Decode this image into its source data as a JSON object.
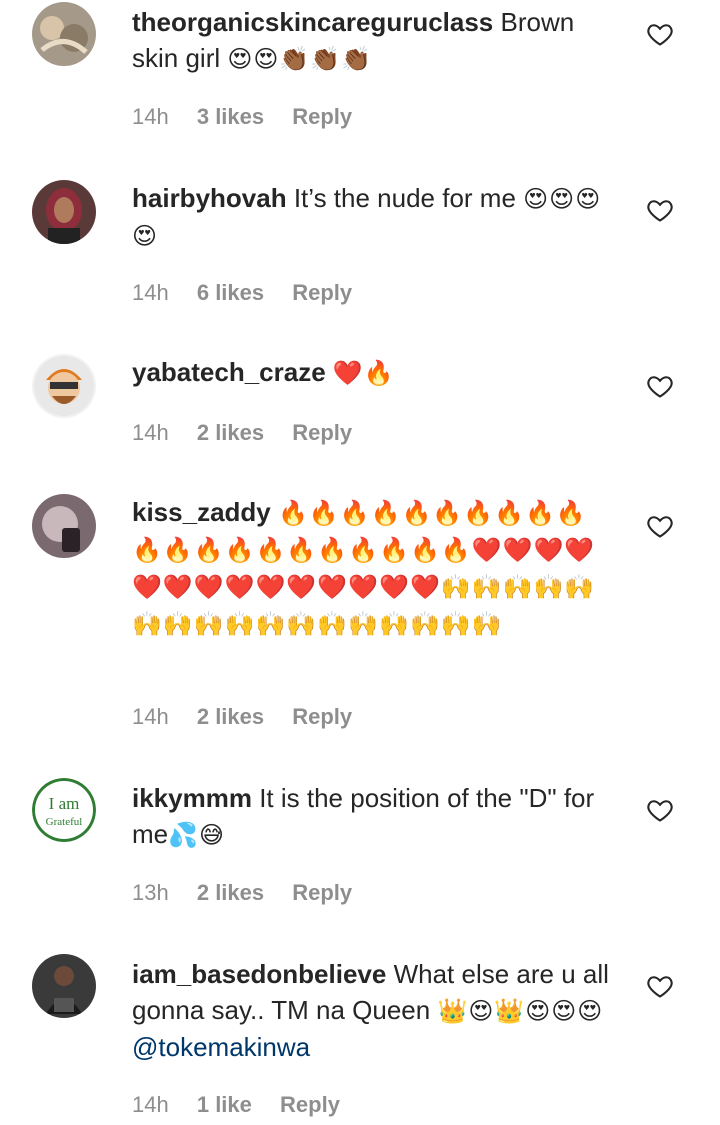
{
  "comments": [
    {
      "username": "theorganicskincareguruclass",
      "text": "Brown skin girl",
      "emoji": "😍😍👏🏾👏🏾👏🏾",
      "time": "14h",
      "likes": "3 likes",
      "reply": "Reply"
    },
    {
      "username": "hairbyhovah",
      "text": "It’s the nude for me",
      "emoji": "😍😍😍😍",
      "time": "14h",
      "likes": "6 likes",
      "reply": "Reply"
    },
    {
      "username": "yabatech_craze",
      "text": "",
      "emoji": "❤️🔥",
      "time": "14h",
      "likes": "2 likes",
      "reply": "Reply"
    },
    {
      "username": "kiss_zaddy",
      "text": "",
      "emoji": "🔥🔥🔥🔥🔥🔥🔥🔥🔥🔥🔥🔥🔥🔥🔥🔥🔥🔥🔥🔥🔥❤️❤️❤️❤️❤️❤️❤️❤️❤️❤️❤️❤️❤️❤️🙌🙌🙌🙌🙌🙌🙌🙌🙌🙌🙌🙌🙌🙌🙌🙌🙌",
      "time": "14h",
      "likes": "2 likes",
      "reply": "Reply"
    },
    {
      "username": "ikkymmm",
      "text": "It is the position of the \"D\" for me",
      "emoji": "💦😅",
      "time": "13h",
      "likes": "2 likes",
      "reply": "Reply",
      "avatar_text": [
        "I am",
        "Grateful"
      ]
    },
    {
      "username": "iam_basedonbelieve",
      "text": "What else are u all gonna say.. TM na Queen",
      "emoji": "👑😍👑😍😍😍",
      "mention": "@tokemakinwa",
      "time": "14h",
      "likes": "1 like",
      "reply": "Reply"
    }
  ]
}
